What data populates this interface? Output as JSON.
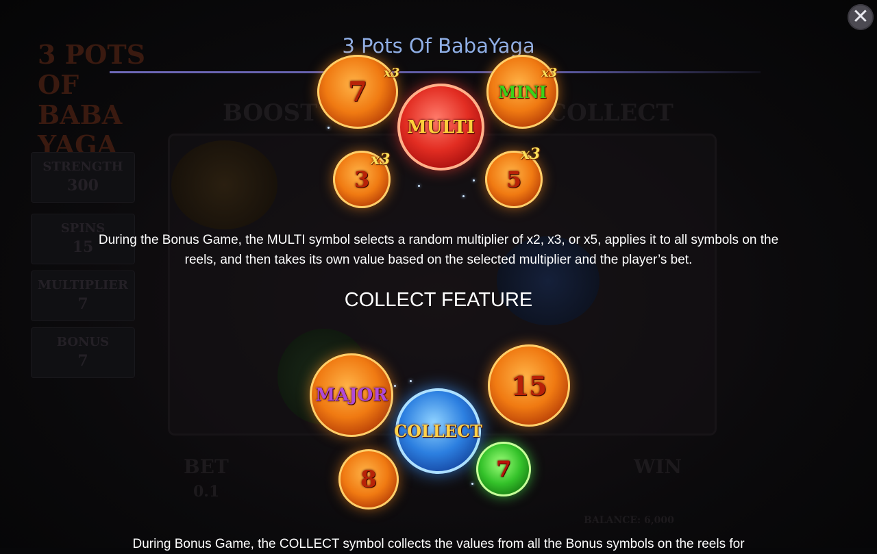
{
  "dialog": {
    "title": "3 Pots Of BabaYaga",
    "close_label": "✕"
  },
  "multi_feature": {
    "coins": {
      "top_left_value": "7",
      "top_left_multiplier": "x3",
      "top_right_label": "MINI",
      "top_right_multiplier": "x3",
      "center_label": "MULTI",
      "bottom_left_value": "3",
      "bottom_left_multiplier": "x3",
      "bottom_right_value": "5",
      "bottom_right_multiplier": "x3"
    },
    "description": "During the Bonus Game, the MULTI symbol selects a random multiplier of x2, x3, or x5, applies it to all symbols on the reels, and then takes its own value based on the selected multiplier and the player’s bet."
  },
  "collect_feature": {
    "heading": "COLLECT FEATURE",
    "coins": {
      "major_label": "MAJOR",
      "top_right_value": "15",
      "center_label": "COLLECT",
      "bottom_left_value": "8",
      "green_value": "7"
    },
    "description": "During Bonus Game, the COLLECT symbol collects the values from all the Bonus symbols on the reels for"
  },
  "background": {
    "logo_text": "3 POTS OF BABA YAGA",
    "side_panels": [
      {
        "label": "STRENGTH",
        "value": "300"
      },
      {
        "label": "SPINS",
        "value": "15"
      },
      {
        "label": "MULTIPLIER",
        "value": "7"
      },
      {
        "label": "BONUS",
        "value": "7"
      }
    ],
    "boost_label": "BOOST",
    "collect_label": "COLLECT",
    "bet_label": "BET",
    "bet_value": "0.1",
    "win_label": "WIN",
    "balance_text": "BALANCE: 6,000"
  },
  "colors": {
    "title": "#8faee5",
    "text": "#ffffff",
    "divider": "#6e68b8"
  }
}
